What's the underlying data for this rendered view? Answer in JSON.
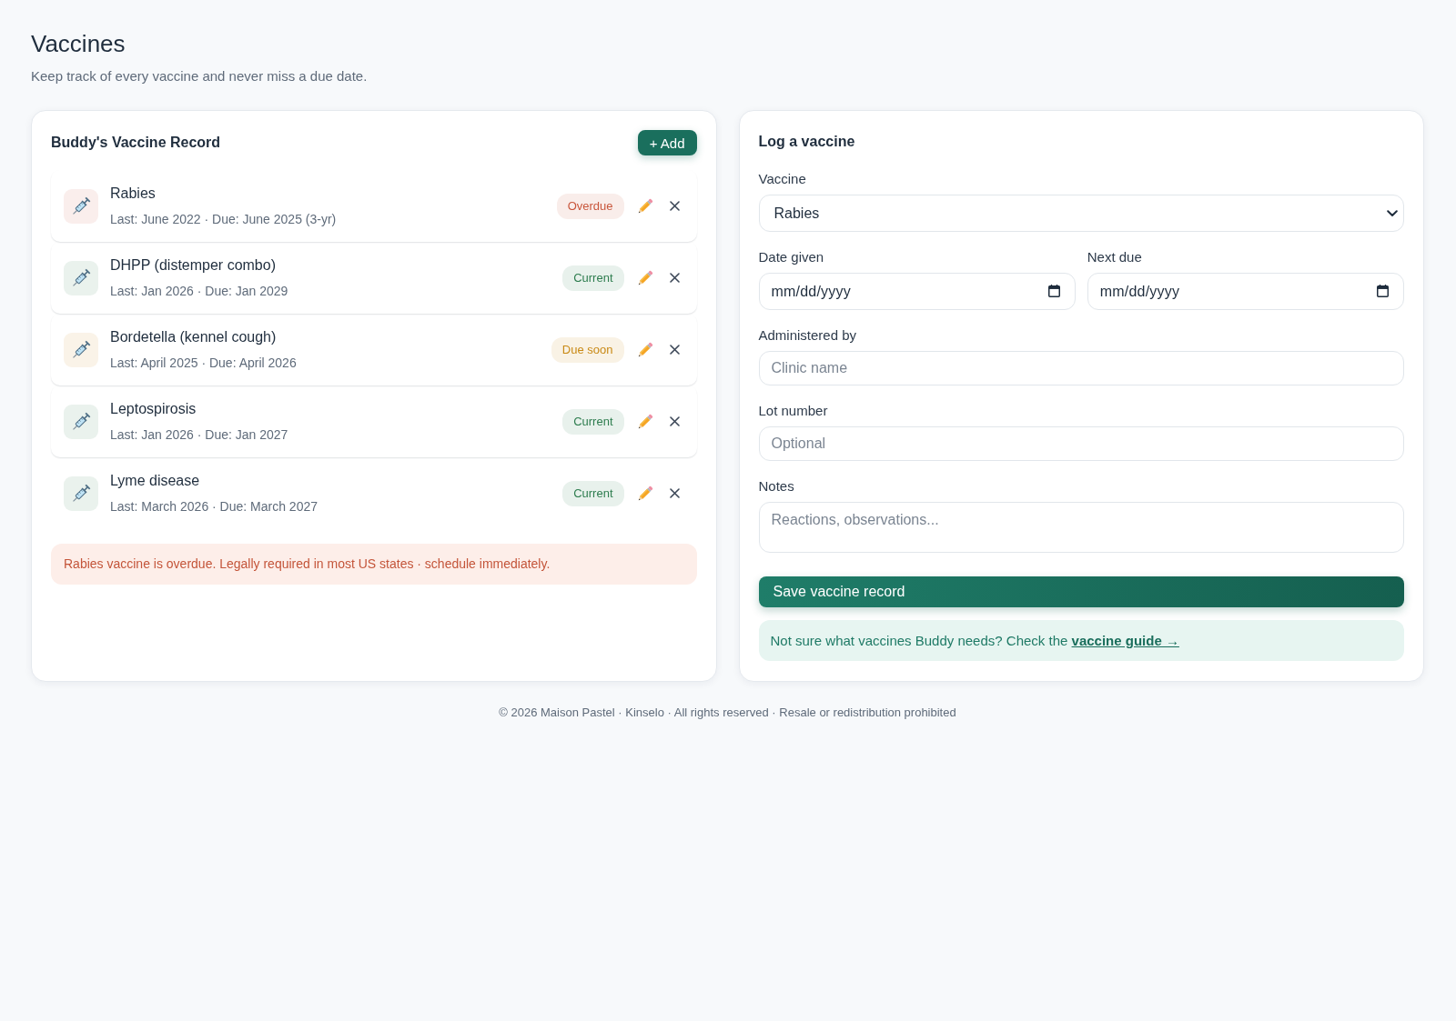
{
  "page": {
    "title": "Vaccines",
    "subtitle": "Keep track of every vaccine and never miss a due date."
  },
  "record": {
    "title": "Buddy's Vaccine Record",
    "add_button": "+ Add",
    "items": [
      {
        "name": "Rabies",
        "detail": "Last: June 2022 · Due: June 2025 (3-yr)",
        "badge": "Overdue",
        "color": "#c9573d"
      },
      {
        "name": "DHPP (distemper combo)",
        "detail": "Last: Jan 2026 · Due: Jan 2029",
        "badge": "Current",
        "color": "#2e7d4f"
      },
      {
        "name": "Bordetella (kennel cough)",
        "detail": "Last: April 2025 · Due: April 2026",
        "badge": "Due soon",
        "color": "#c98a16"
      },
      {
        "name": "Leptospirosis",
        "detail": "Last: Jan 2026 · Due: Jan 2027",
        "badge": "Current",
        "color": "#2e7d4f"
      },
      {
        "name": "Lyme disease",
        "detail": "Last: March 2026 · Due: March 2027",
        "badge": "Current",
        "color": "#2e7d4f"
      }
    ],
    "alert": "Rabies vaccine is overdue. Legally required in most US states · schedule immediately."
  },
  "form": {
    "title": "Log a vaccine",
    "fields": [
      {
        "kind": "select",
        "label": "Vaccine",
        "value": "Rabies"
      },
      {
        "kind": "date",
        "label": "Date given",
        "placeholder": "mm/dd/yyyy"
      },
      {
        "kind": "date",
        "label": "Next due",
        "placeholder": "mm/dd/yyyy"
      },
      {
        "kind": "text",
        "label": "Administered by",
        "placeholder": "Clinic name"
      },
      {
        "kind": "text",
        "label": "Lot number",
        "placeholder": "Optional"
      },
      {
        "kind": "textarea",
        "label": "Notes",
        "placeholder": "Reactions, observations..."
      }
    ],
    "save_button": "Save vaccine record",
    "hint": {
      "text": "Not sure what vaccines Buddy needs? Check the",
      "link": "vaccine guide →"
    }
  },
  "footer": "© 2026 Maison Pastel · Kinselo · All rights reserved · Resale or redistribution prohibited"
}
